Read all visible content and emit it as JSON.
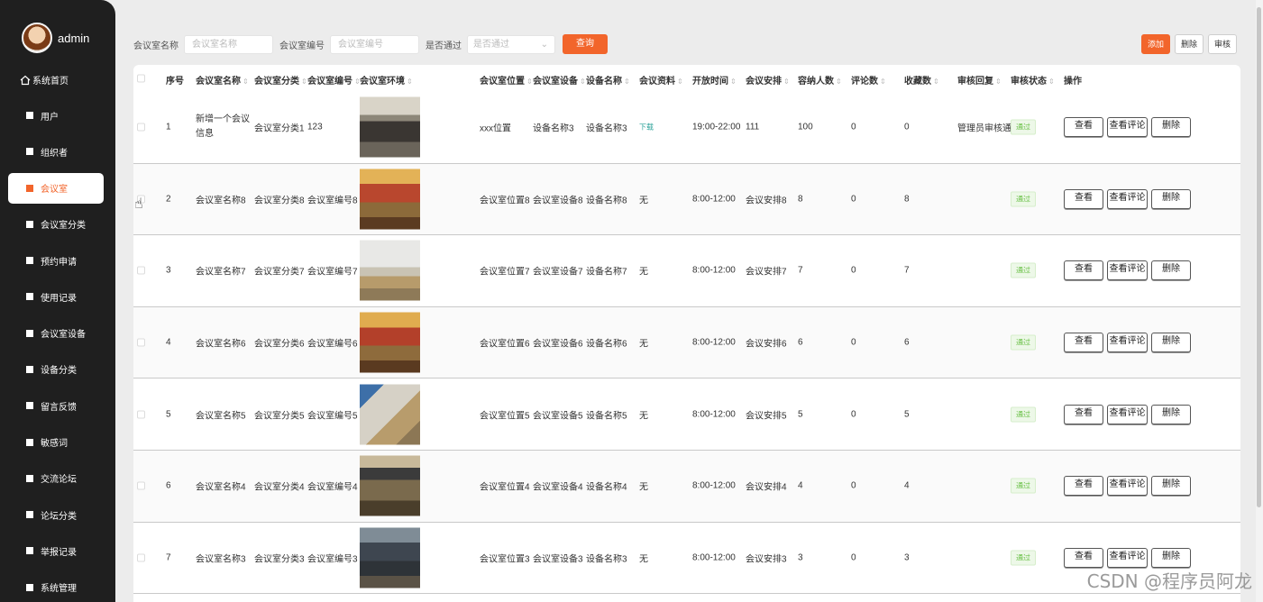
{
  "sidebar": {
    "username": "admin",
    "home_label": "系统首页",
    "items": [
      {
        "label": "用户",
        "icon": "person-icon"
      },
      {
        "label": "组织者",
        "icon": "person-icon"
      },
      {
        "label": "会议室",
        "icon": "grid-icon",
        "active": true
      },
      {
        "label": "会议室分类",
        "icon": "chat-icon"
      },
      {
        "label": "预约申请",
        "icon": "doc-icon"
      },
      {
        "label": "使用记录",
        "icon": "grid-icon"
      },
      {
        "label": "会议室设备",
        "icon": "pie-icon"
      },
      {
        "label": "设备分类",
        "icon": "grid-icon"
      },
      {
        "label": "留言反馈",
        "icon": "message-icon"
      },
      {
        "label": "敏感词",
        "icon": "bar-chart-icon"
      },
      {
        "label": "交流论坛",
        "icon": "grid-icon"
      },
      {
        "label": "论坛分类",
        "icon": "grid-icon"
      },
      {
        "label": "举报记录",
        "icon": "doc-icon"
      },
      {
        "label": "系统管理",
        "icon": "monitor-icon"
      }
    ]
  },
  "search": {
    "name_label": "会议室名称",
    "name_placeholder": "会议室名称",
    "code_label": "会议室编号",
    "code_placeholder": "会议室编号",
    "pass_label": "是否通过",
    "pass_placeholder": "是否通过",
    "query_button": "查询"
  },
  "toolbar": {
    "add": "添加",
    "delete": "删除",
    "review": "审核"
  },
  "accent_color": "#f2652b",
  "table": {
    "headers": [
      "序号",
      "会议室名称",
      "会议室分类",
      "会议室编号",
      "会议室环境",
      "会议室位置",
      "会议室设备",
      "设备名称",
      "会议资料",
      "开放时间",
      "会议安排",
      "容纳人数",
      "评论数",
      "收藏数",
      "审核回复",
      "审核状态",
      "操作"
    ],
    "action_labels": {
      "view": "查看",
      "comments": "查看评论",
      "delete": "删除"
    },
    "rows": [
      {
        "no": "1",
        "name": "新增一个会议信息",
        "category": "会议室分类1",
        "code": "123",
        "location": "xxx位置",
        "equipment": "设备名称3",
        "device_name": "设备名称3",
        "material": "下载",
        "open_time": "19:00-22:00",
        "schedule": "111",
        "capacity": "100",
        "comments": "0",
        "favorites": "0",
        "reply": "管理员审核通",
        "status": "通过"
      },
      {
        "no": "2",
        "name": "会议室名称8",
        "category": "会议室分类8",
        "code": "会议室编号8",
        "location": "会议室位置8",
        "equipment": "会议室设备8",
        "device_name": "设备名称8",
        "material": "无",
        "open_time": "8:00-12:00",
        "schedule": "会议安排8",
        "capacity": "8",
        "comments": "0",
        "favorites": "8",
        "reply": "",
        "status": "通过"
      },
      {
        "no": "3",
        "name": "会议室名称7",
        "category": "会议室分类7",
        "code": "会议室编号7",
        "location": "会议室位置7",
        "equipment": "会议室设备7",
        "device_name": "设备名称7",
        "material": "无",
        "open_time": "8:00-12:00",
        "schedule": "会议安排7",
        "capacity": "7",
        "comments": "0",
        "favorites": "7",
        "reply": "",
        "status": "通过"
      },
      {
        "no": "4",
        "name": "会议室名称6",
        "category": "会议室分类6",
        "code": "会议室编号6",
        "location": "会议室位置6",
        "equipment": "会议室设备6",
        "device_name": "设备名称6",
        "material": "无",
        "open_time": "8:00-12:00",
        "schedule": "会议安排6",
        "capacity": "6",
        "comments": "0",
        "favorites": "6",
        "reply": "",
        "status": "通过"
      },
      {
        "no": "5",
        "name": "会议室名称5",
        "category": "会议室分类5",
        "code": "会议室编号5",
        "location": "会议室位置5",
        "equipment": "会议室设备5",
        "device_name": "设备名称5",
        "material": "无",
        "open_time": "8:00-12:00",
        "schedule": "会议安排5",
        "capacity": "5",
        "comments": "0",
        "favorites": "5",
        "reply": "",
        "status": "通过"
      },
      {
        "no": "6",
        "name": "会议室名称4",
        "category": "会议室分类4",
        "code": "会议室编号4",
        "location": "会议室位置4",
        "equipment": "会议室设备4",
        "device_name": "设备名称4",
        "material": "无",
        "open_time": "8:00-12:00",
        "schedule": "会议安排4",
        "capacity": "4",
        "comments": "0",
        "favorites": "4",
        "reply": "",
        "status": "通过"
      },
      {
        "no": "7",
        "name": "会议室名称3",
        "category": "会议室分类3",
        "code": "会议室编号3",
        "location": "会议室位置3",
        "equipment": "会议室设备3",
        "device_name": "设备名称3",
        "material": "无",
        "open_time": "8:00-12:00",
        "schedule": "会议安排3",
        "capacity": "3",
        "comments": "0",
        "favorites": "3",
        "reply": "",
        "status": "通过"
      }
    ]
  },
  "watermark": "CSDN @程序员阿龙"
}
